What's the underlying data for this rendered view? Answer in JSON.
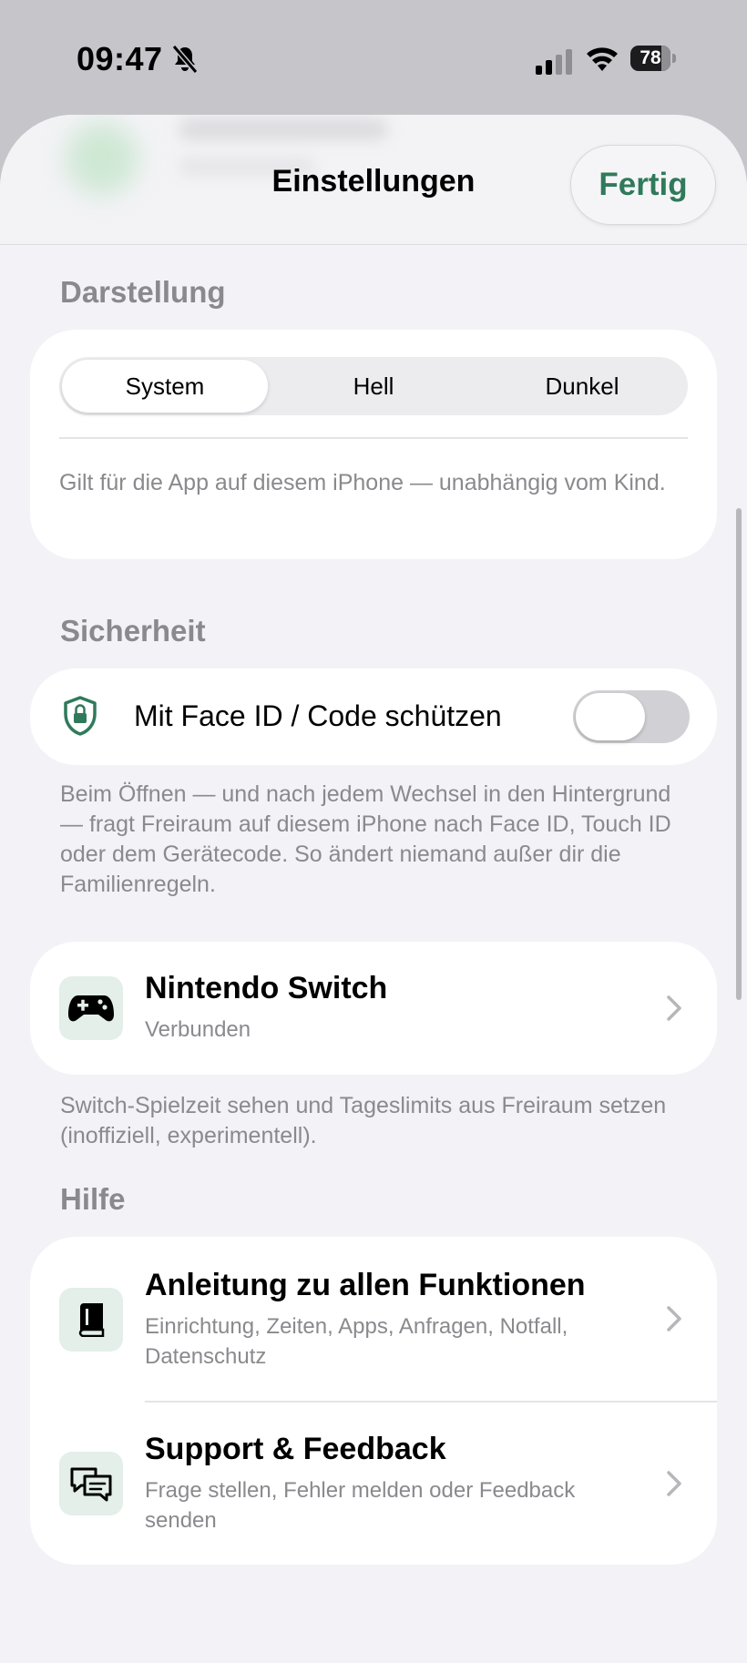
{
  "status_bar": {
    "time": "09:47",
    "battery": "78",
    "battery_level": 0.78
  },
  "header": {
    "title": "Einstellungen",
    "done_label": "Fertig"
  },
  "appearance": {
    "section_label": "Darstellung",
    "options": [
      "System",
      "Hell",
      "Dunkel"
    ],
    "selected": "System",
    "footnote": "Gilt für die App auf diesem iPhone — unabhängig vom Kind."
  },
  "security": {
    "section_label": "Sicherheit",
    "toggle_label": "Mit Face ID / Code schützen",
    "toggle_on": false,
    "footnote": "Beim Öffnen — und nach jedem Wechsel in den Hintergrund — fragt Freiraum auf diesem iPhone nach Face ID, Touch ID oder dem Gerätecode. So ändert niemand außer dir die Familienregeln."
  },
  "switch": {
    "title": "Nintendo Switch",
    "subtitle": "Verbunden",
    "footnote": "Switch-Spielzeit sehen und Tageslimits aus Freiraum setzen (inoffiziell, experimentell)."
  },
  "help": {
    "section_label": "Hilfe",
    "items": [
      {
        "title": "Anleitung zu allen Funktionen",
        "subtitle": "Einrichtung, Zeiten, Apps, Anfragen, Notfall, Datenschutz",
        "icon": "book-icon"
      },
      {
        "title": "Support & Feedback",
        "subtitle": "Frage stellen, Fehler melden oder Feedback senden",
        "icon": "chat-bubbles-icon"
      }
    ]
  },
  "colors": {
    "accent": "#2f7a5b",
    "icon_bg": "#e3efe8",
    "background": "#f2f2f7"
  }
}
